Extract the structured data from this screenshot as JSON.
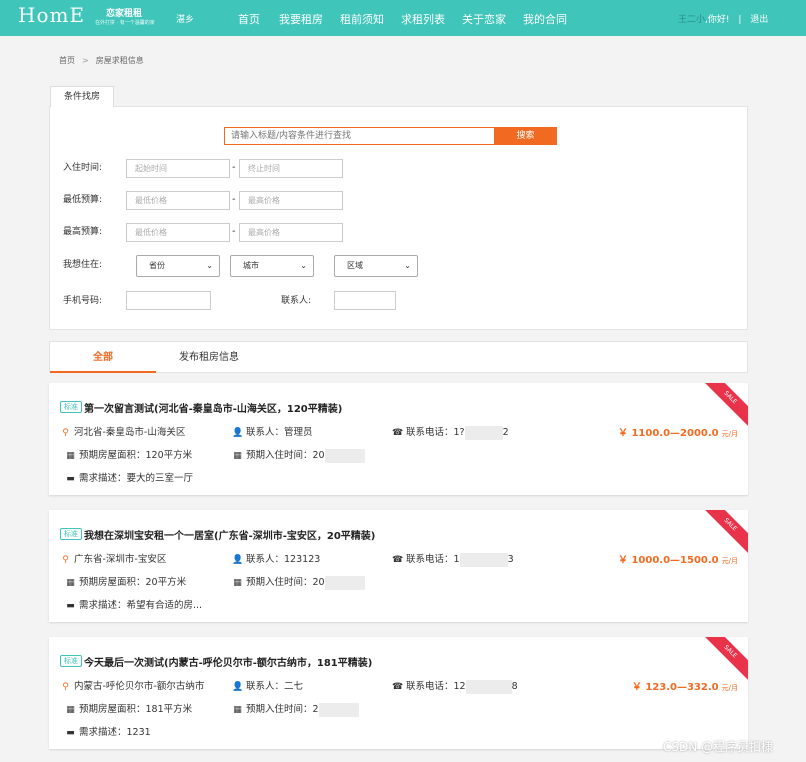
{
  "header": {
    "logo": "HomE",
    "logo_sub": "恋家租租",
    "logo_slogan": "在外打拼 · 有一个温馨的家",
    "city": "湛乡",
    "nav": [
      "首页",
      "我要租房",
      "租前须知",
      "求租列表",
      "关于恋家",
      "我的合同"
    ],
    "user_name": "王二小",
    "greeting": ",你好!",
    "separator": "|",
    "logout": "退出"
  },
  "breadcrumb": {
    "home": "首页",
    "sep": ">",
    "current": "房屋求租信息"
  },
  "filter": {
    "tab": "条件找房",
    "search_placeholder": "请输入标题/内容条件进行查找",
    "search_button": "搜索",
    "checkin_label": "入住时间:",
    "checkin_start": "起始时间",
    "checkin_end": "终止时间",
    "min_budget_label": "最低预算:",
    "min_low": "最低价格",
    "min_high": "最高价格",
    "max_budget_label": "最高预算:",
    "max_low": "最低价格",
    "max_high": "最高价格",
    "dash": "-",
    "live_label": "我想住在:",
    "province": "省份",
    "city": "城市",
    "district": "区域",
    "phone_label": "手机号码:",
    "contact_label": "联系人:"
  },
  "tabs": [
    "全部",
    "发布租房信息"
  ],
  "listings": [
    {
      "badge": "标准",
      "title": "第一次留言测试(河北省-秦皇岛市-山海关区，120平精装)",
      "location": "河北省-秦皇岛市-山海关区",
      "contact_label": "联系人：",
      "contact": "管理员",
      "phone_label": "联系电话：",
      "phone_prefix": "1?",
      "phone_suffix": "2",
      "price": "￥ 1100.0—2000.0",
      "unit": "元/月",
      "area_label": "预期房屋面积：",
      "area": "120平方米",
      "checkin_label": "预期入住时间：",
      "checkin": "20",
      "desc_label": "需求描述：",
      "desc": "要大的三室一厅",
      "sale": "SALE"
    },
    {
      "badge": "标准",
      "title": "我想在深圳宝安租一个一居室(广东省-深圳市-宝安区，20平精装)",
      "location": "广东省-深圳市-宝安区",
      "contact_label": "联系人：",
      "contact": "123123",
      "phone_label": "联系电话：",
      "phone_prefix": "1",
      "phone_suffix": "3",
      "price": "￥ 1000.0—1500.0",
      "unit": "元/月",
      "area_label": "预期房屋面积：",
      "area": "20平方米",
      "checkin_label": "预期入住时间：",
      "checkin": "20",
      "desc_label": "需求描述：",
      "desc": "希望有合适的房...",
      "sale": "SALE"
    },
    {
      "badge": "标准",
      "title": "今天最后一次测试(内蒙古-呼伦贝尔市-额尔古纳市，181平精装)",
      "location": "内蒙古-呼伦贝尔市-额尔古纳市",
      "contact_label": "联系人：",
      "contact": "二七",
      "phone_label": "联系电话：",
      "phone_prefix": "12",
      "phone_suffix": "8",
      "price": "￥ 123.0—332.0",
      "unit": "元/月",
      "area_label": "预期房屋面积：",
      "area": "181平方米",
      "checkin_label": "预期入住时间：",
      "checkin": "2",
      "desc_label": "需求描述：",
      "desc": "1231",
      "sale": "SALE"
    }
  ],
  "watermark": "CSDN @程序员扣棣"
}
